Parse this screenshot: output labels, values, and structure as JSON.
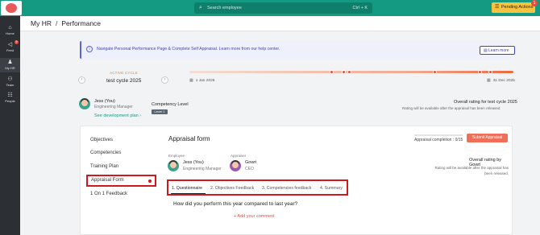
{
  "topbar": {
    "search_placeholder": "Search employee",
    "search_shortcut": "Ctrl + K",
    "pending_label": "Pending Actions",
    "pending_count": "1",
    "colors": {
      "topbar": "#149a82",
      "pending": "#f6c340",
      "badge": "#e74c3c"
    }
  },
  "sidebar": {
    "items": [
      {
        "label": "Home",
        "icon": "home-icon"
      },
      {
        "label": "Feed",
        "icon": "megaphone-icon",
        "badge": "9"
      },
      {
        "label": "My HR",
        "icon": "person-icon"
      },
      {
        "label": "Team",
        "icon": "team-icon"
      },
      {
        "label": "People",
        "icon": "org-chart-icon"
      }
    ]
  },
  "header": {
    "crumb_root": "My HR",
    "crumb_sep": "/",
    "crumb_current": "Performance"
  },
  "banner": {
    "text": "Navigate Personal Performance Page & Complete Self Appraisal. Learn more from our help center.",
    "learn_more": "Learn more"
  },
  "cycle": {
    "label": "ACTIVE CYCLE",
    "name": "test cycle 2025",
    "start_date": "1 Jan 2025",
    "end_date": "31 Dec 2025",
    "progress_percent": 100
  },
  "user": {
    "name": "Jess (You)",
    "role": "Engineering Manager",
    "competency_label": "Competency Level",
    "competency_level": "Level 1",
    "dev_plan": "See development plan",
    "overall_title": "Overall rating for test cycle 2025",
    "overall_note": "Rating will be available after the appraisal has been released"
  },
  "menu": {
    "items": [
      "Objectives",
      "Competencies",
      "Training Plan"
    ],
    "active": "Appraisal Form",
    "last": "1 On 1 Feedback"
  },
  "form": {
    "title": "Appraisal form",
    "completion": "Appraisal completion : 0/15",
    "completion_fraction": 0,
    "submit": "Submit Appraisal",
    "employee_label": "Employee",
    "employee_name": "Jess (You)",
    "employee_role": "Engineering Manager",
    "appraiser_label": "Appraiser",
    "appraiser_name": "Gowri",
    "appraiser_role": "CEO",
    "rating_by": "Overall rating by Gowri",
    "rating_note": "Rating will be available after the appraisal has been released.",
    "tabs": [
      "1. Questionnaire",
      "2. Objectives Feedback",
      "3. Competencies feedback",
      "4. Summary"
    ],
    "question": "How did you perform this year compared to last year?",
    "add_comment": "+ Add your comment"
  }
}
